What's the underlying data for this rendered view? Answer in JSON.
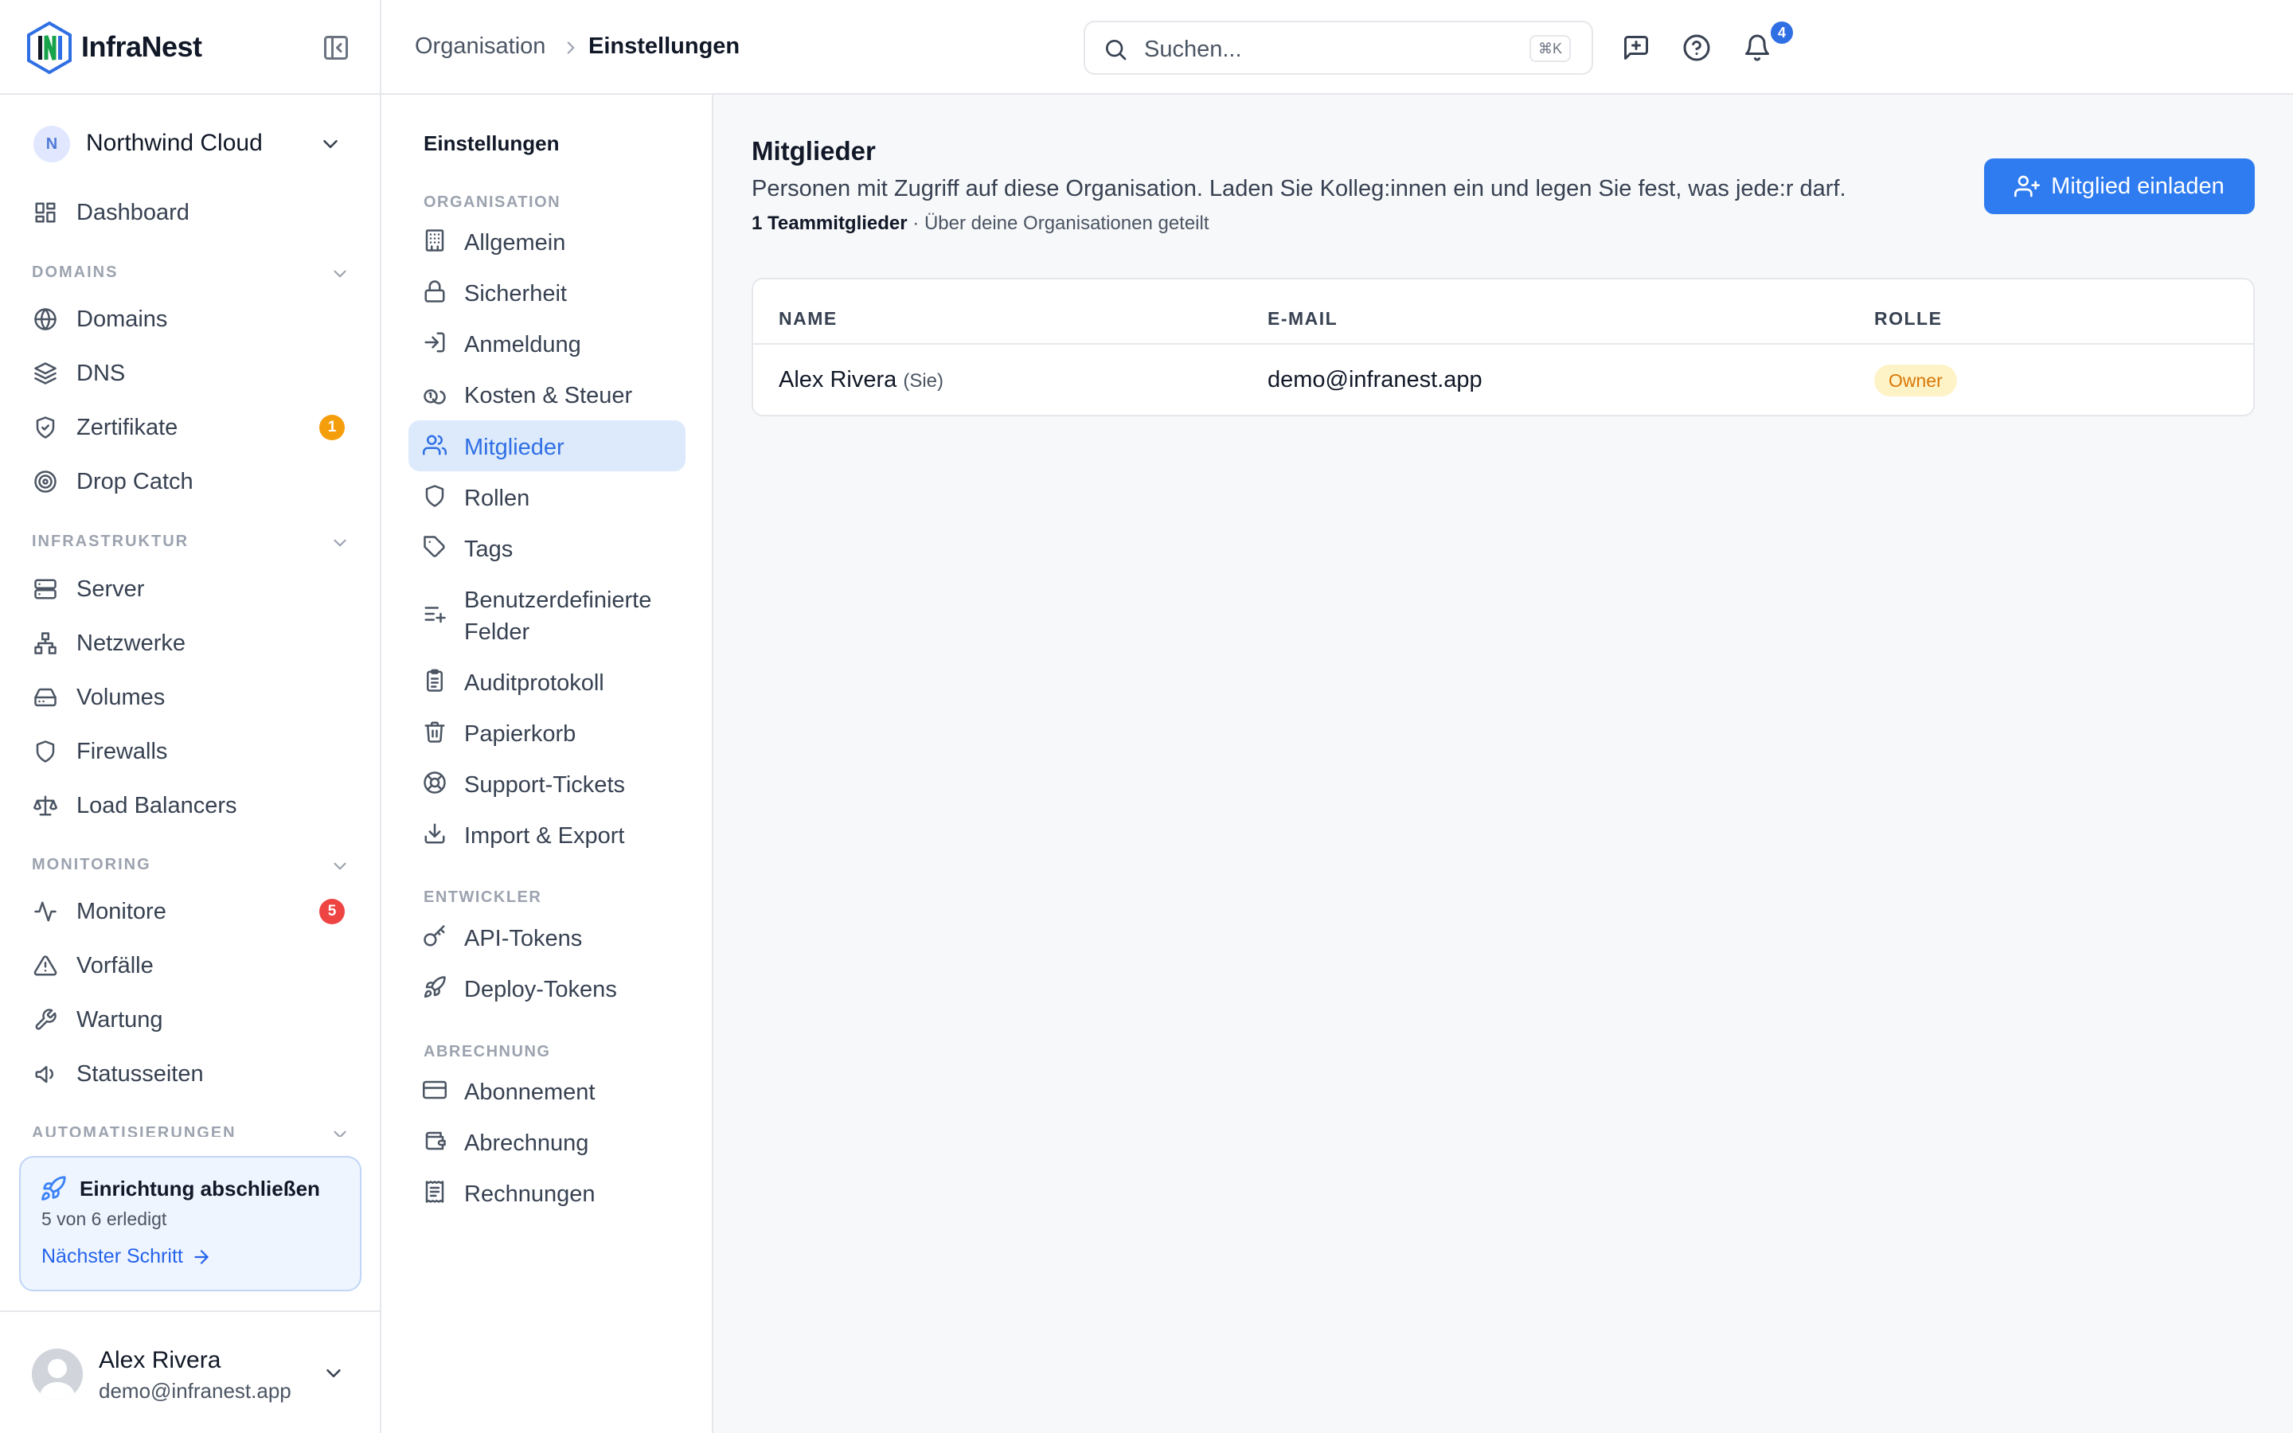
{
  "app": {
    "name": "InfraNest"
  },
  "org": {
    "initial": "N",
    "name": "Northwind Cloud"
  },
  "nav": {
    "dashboard": "Dashboard",
    "sections": {
      "domains": "DOMAINS",
      "infra": "INFRASTRUKTUR",
      "monitoring": "MONITORING",
      "automation": "AUTOMATISIERUNGEN"
    },
    "domains": "Domains",
    "dns": "DNS",
    "certs": "Zertifikate",
    "certs_badge": "1",
    "dropcatch": "Drop Catch",
    "server": "Server",
    "networks": "Netzwerke",
    "volumes": "Volumes",
    "firewalls": "Firewalls",
    "lb": "Load Balancers",
    "monitors": "Monitore",
    "monitors_badge": "5",
    "incidents": "Vorfälle",
    "maintenance": "Wartung",
    "statuspages": "Statusseiten"
  },
  "setup": {
    "title": "Einrichtung abschließen",
    "progress": "5 von 6 erledigt",
    "next": "Nächster Schritt"
  },
  "user": {
    "name": "Alex Rivera",
    "email": "demo@infranest.app"
  },
  "topbar": {
    "crumb_parent": "Organisation",
    "crumb_current": "Einstellungen",
    "search_placeholder": "Suchen...",
    "search_shortcut": "⌘K",
    "notifications_count": "4"
  },
  "subnav": {
    "title": "Einstellungen",
    "section_org": "ORGANISATION",
    "section_dev": "ENTWICKLER",
    "section_billing": "ABRECHNUNG",
    "general": "Allgemein",
    "security": "Sicherheit",
    "login": "Anmeldung",
    "costs": "Kosten & Steuer",
    "members": "Mitglieder",
    "roles": "Rollen",
    "tags": "Tags",
    "custom_fields": "Benutzerdefinierte Felder",
    "audit": "Auditprotokoll",
    "trash": "Papierkorb",
    "support": "Support-Tickets",
    "import_export": "Import & Export",
    "api_tokens": "API-Tokens",
    "deploy_tokens": "Deploy-Tokens",
    "subscription": "Abonnement",
    "billing": "Abrechnung",
    "invoices": "Rechnungen"
  },
  "main": {
    "title": "Mitglieder",
    "description": "Personen mit Zugriff auf diese Organisation. Laden Sie Kolleg:innen ein und legen Sie fest, was jede:r darf.",
    "member_count": "1 Teammitglieder",
    "member_count_suffix": " · Über deine Organisationen geteilt",
    "invite_label": "Mitglied einladen",
    "table": {
      "col_name": "NAME",
      "col_email": "E-MAIL",
      "col_role": "ROLLE",
      "rows": [
        {
          "name": "Alex Rivera",
          "you": "(Sie)",
          "email": "demo@infranest.app",
          "role": "Owner"
        }
      ]
    }
  },
  "colors": {
    "accent": "#2f7cf0",
    "active_bg": "#dceafc",
    "badge_orange": "#f59e0b",
    "badge_red": "#ef4444",
    "role_badge_bg": "#fef3c7",
    "role_badge_fg": "#d97706"
  }
}
